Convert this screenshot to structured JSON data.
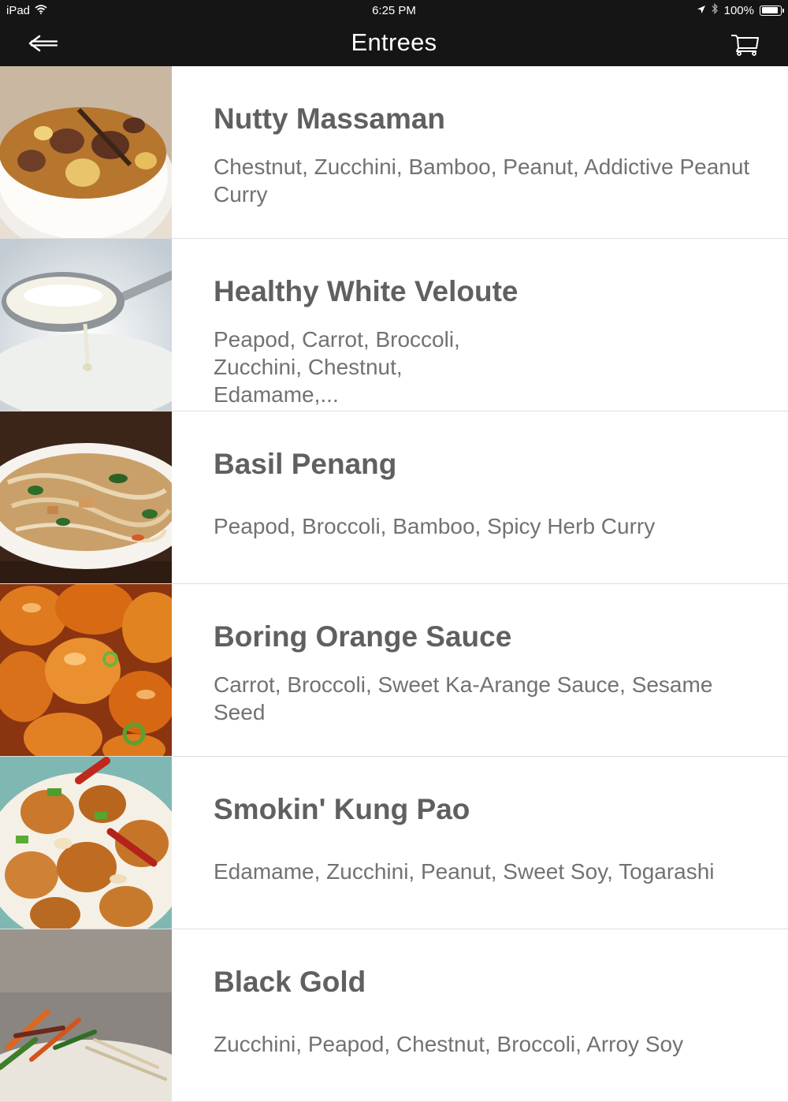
{
  "status_bar": {
    "device": "iPad",
    "time": "6:25 PM",
    "battery": "100%",
    "battery_level": 1.0
  },
  "nav": {
    "title": "Entrees",
    "back_icon": "arrow-left-icon",
    "cart_icon": "cart-icon"
  },
  "entrees": [
    {
      "name": "Nutty Massaman",
      "description": "Chestnut, Zucchini, Bamboo, Peanut, Addictive Peanut Curry"
    },
    {
      "name": "Healthy White Veloute",
      "description": "Peapod, Carrot, Broccoli, Zucchini, Chestnut, Edamame,..."
    },
    {
      "name": "Basil Penang",
      "description": "Peapod, Broccoli, Bamboo, Spicy Herb Curry"
    },
    {
      "name": "Boring Orange Sauce",
      "description": "Carrot, Broccoli, Sweet Ka-Arange Sauce, Sesame Seed"
    },
    {
      "name": "Smokin' Kung Pao",
      "description": "Edamame, Zucchini, Peanut, Sweet Soy, Togarashi"
    },
    {
      "name": "Black Gold",
      "description": "Zucchini, Peapod, Chestnut, Broccoli, Arroy Soy"
    }
  ],
  "colors": {
    "bar_background": "#151515",
    "title_text": "#606060",
    "description_text": "#727272",
    "divider": "#dedede"
  }
}
